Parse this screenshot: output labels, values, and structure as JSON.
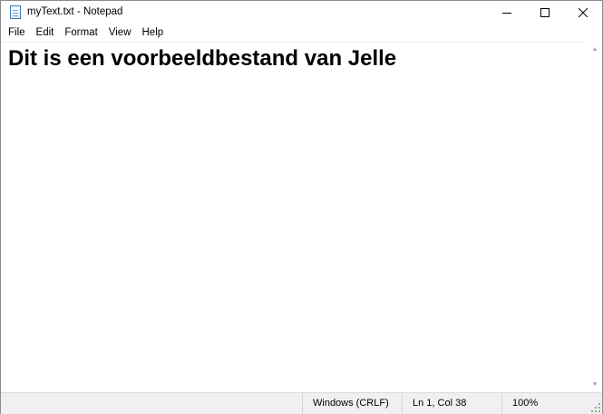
{
  "window": {
    "title": "myText.txt - Notepad",
    "icons": {
      "app": "notepad-icon",
      "minimize": "minimize-icon",
      "maximize": "maximize-icon",
      "close": "close-icon"
    }
  },
  "menu": {
    "items": [
      "File",
      "Edit",
      "Format",
      "View",
      "Help"
    ]
  },
  "editor": {
    "content": "Dit is een voorbeeldbestand van Jelle"
  },
  "statusbar": {
    "line_ending": "Windows (CRLF)",
    "position": "Ln 1, Col 38",
    "zoom": "100%"
  }
}
